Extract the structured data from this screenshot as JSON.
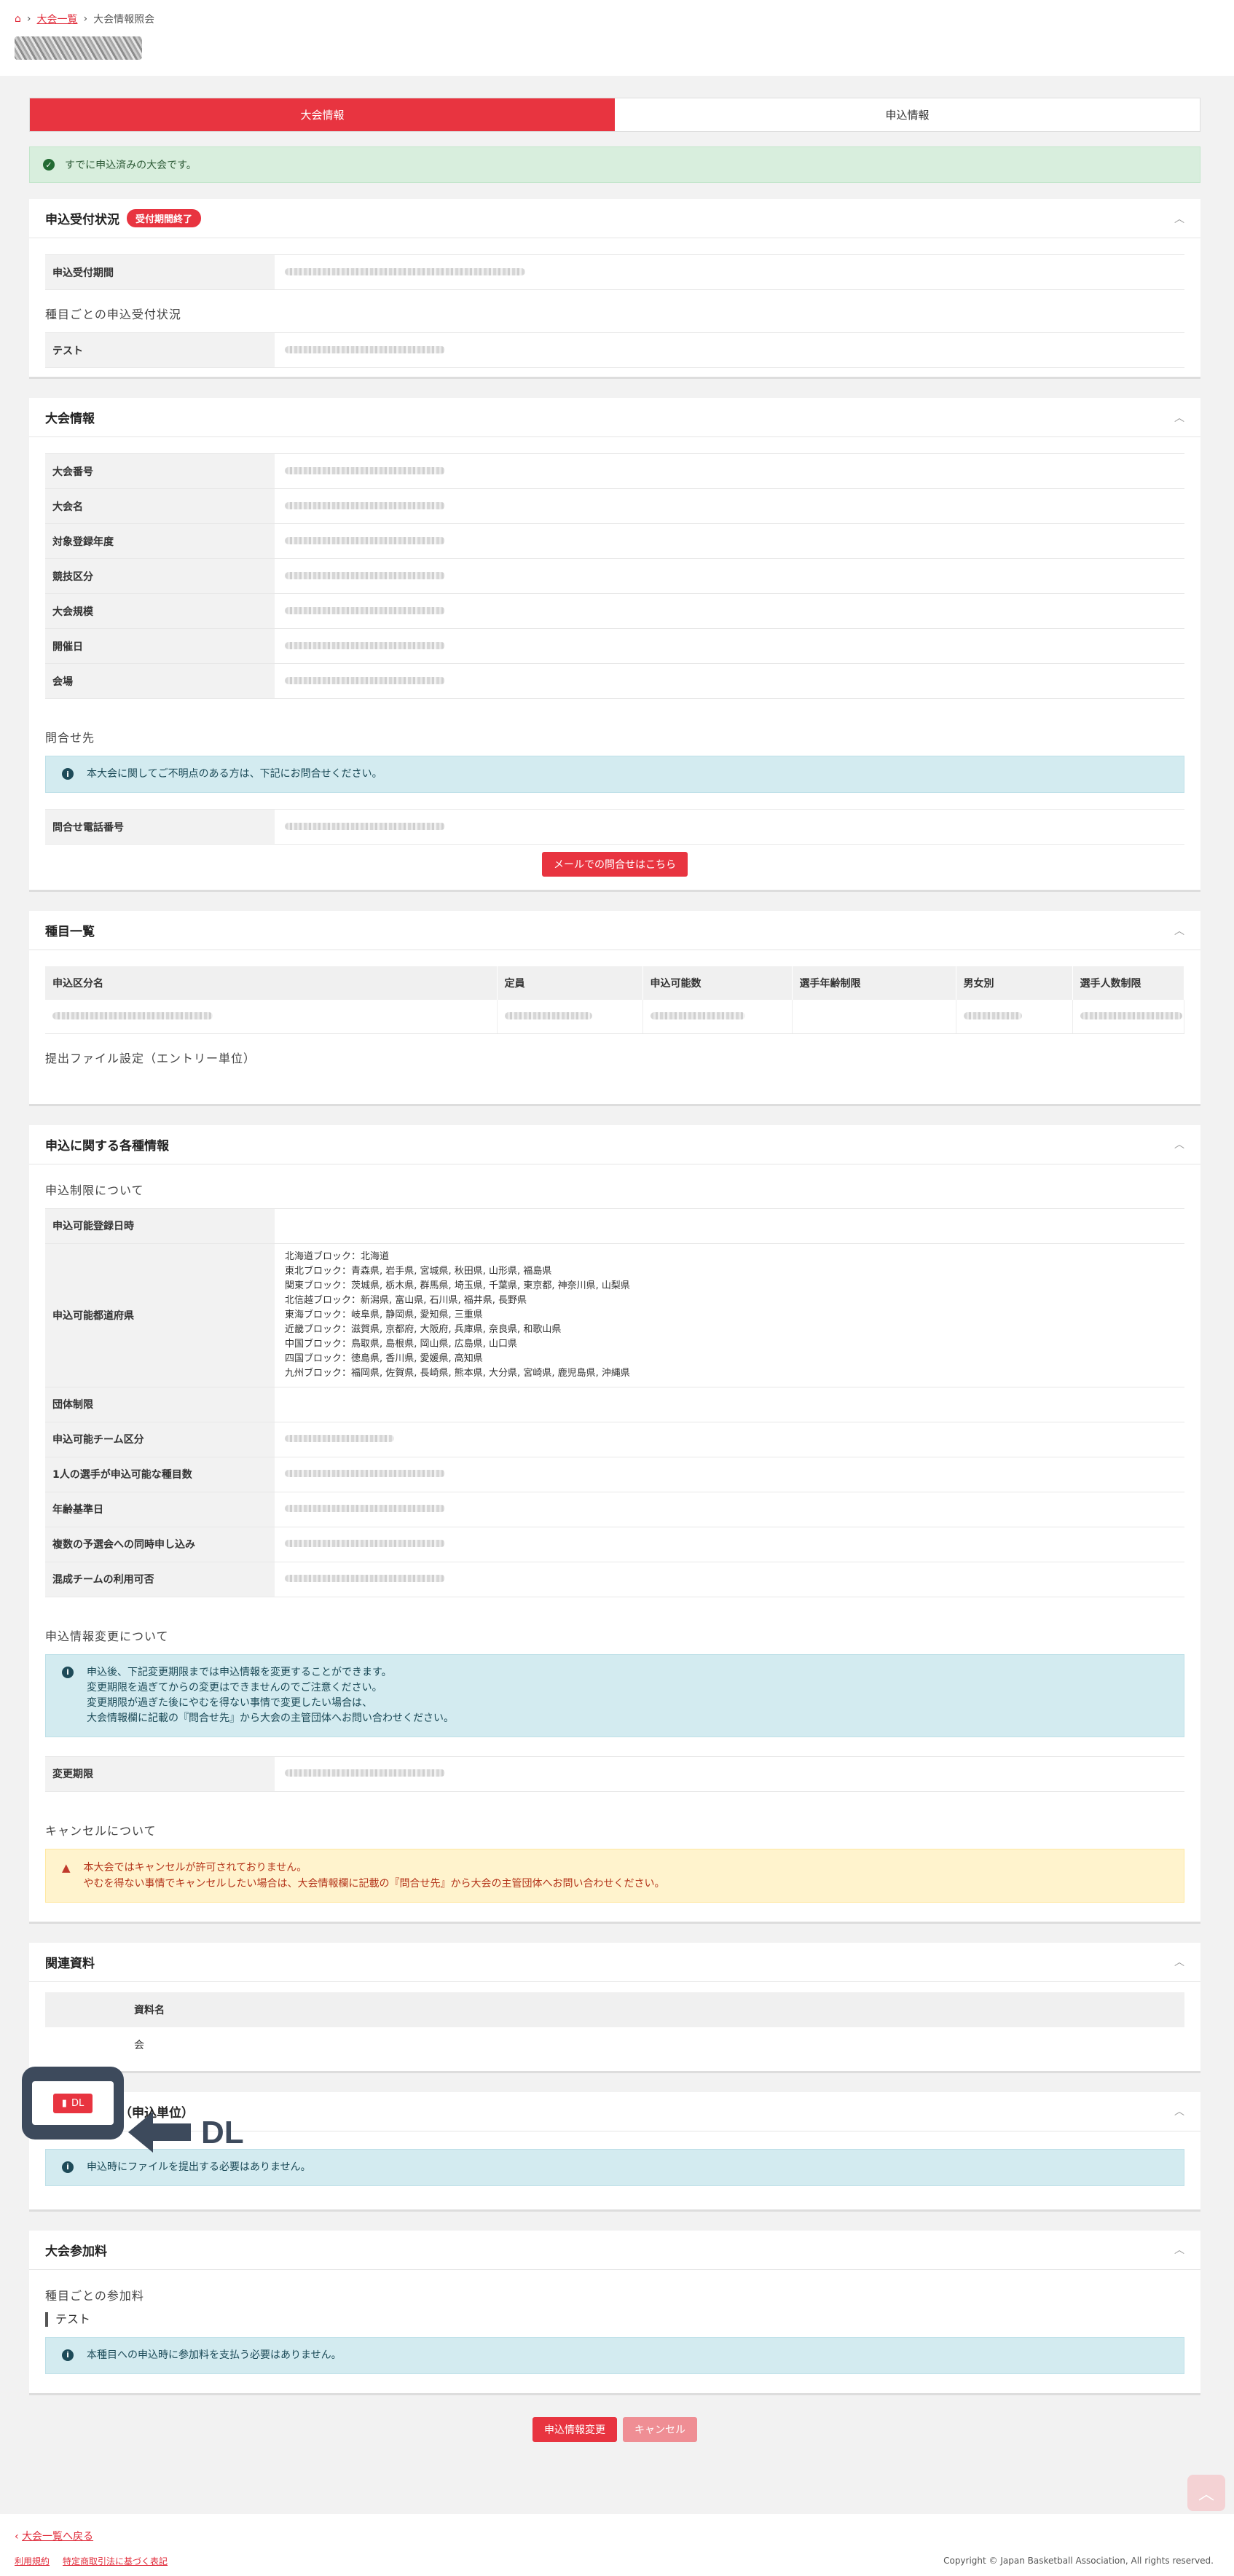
{
  "breadcrumb": {
    "home_icon": "home-icon",
    "link": "大会一覧",
    "current": "大会情報照会"
  },
  "tabs": [
    {
      "label": "大会情報"
    },
    {
      "label": "申込情報"
    }
  ],
  "alert": {
    "text": "すでに申込済みの大会です。"
  },
  "reception": {
    "title": "申込受付状況",
    "badge": "受付期間終了",
    "rows": [
      {
        "label": "申込受付期間"
      }
    ],
    "sub_title": "種目ごとの申込受付状況",
    "event_rows": [
      {
        "label": "テスト"
      }
    ]
  },
  "tournament": {
    "title": "大会情報",
    "rows": [
      "大会番号",
      "大会名",
      "対象登録年度",
      "競技区分",
      "大会規模",
      "開催日",
      "会場"
    ],
    "contact_title": "問合せ先",
    "contact_info": "本大会に関してご不明点のある方は、下記にお問合せください。",
    "phone_label": "問合せ電話番号",
    "mail_button": "メールでの問合せはこちら"
  },
  "events": {
    "title": "種目一覧",
    "columns": [
      "申込区分名",
      "定員",
      "申込可能数",
      "選手年齢制限",
      "男女別",
      "選手人数制限"
    ],
    "file_settings": "提出ファイル設定（エントリー単位）"
  },
  "application": {
    "title": "申込に関する各種情報",
    "limit_title": "申込制限について",
    "rows": [
      {
        "label": "申込可能登録日時"
      },
      {
        "label": "申込可能都道府県"
      },
      {
        "label": "団体制限"
      },
      {
        "label": "申込可能チーム区分"
      },
      {
        "label": "1人の選手が申込可能な種目数"
      },
      {
        "label": "年齢基準日"
      },
      {
        "label": "複数の予選会への同時申し込み"
      },
      {
        "label": "混成チームの利用可否"
      }
    ],
    "prefectures": [
      "北海道ブロック：北海道",
      "東北ブロック：青森県, 岩手県, 宮城県, 秋田県, 山形県, 福島県",
      "関東ブロック：茨城県, 栃木県, 群馬県, 埼玉県, 千葉県, 東京都, 神奈川県, 山梨県",
      "北信越ブロック：新潟県, 富山県, 石川県, 福井県, 長野県",
      "東海ブロック：岐阜県, 静岡県, 愛知県, 三重県",
      "近畿ブロック：滋賀県, 京都府, 大阪府, 兵庫県, 奈良県, 和歌山県",
      "中国ブロック：鳥取県, 島根県, 岡山県, 広島県, 山口県",
      "四国ブロック：徳島県, 香川県, 愛媛県, 高知県",
      "九州ブロック：福岡県, 佐賀県, 長崎県, 熊本県, 大分県, 宮崎県, 鹿児島県, 沖縄県"
    ],
    "change_title": "申込情報変更について",
    "change_info": [
      "申込後、下記変更期限までは申込情報を変更することができます。",
      "変更期限を過ぎてからの変更はできませんのでご注意ください。",
      "変更期限が過ぎた後にやむを得ない事情で変更したい場合は、",
      "大会情報欄に記載の『問合せ先』から大会の主管団体へお問い合わせください。"
    ],
    "change_label": "変更期限",
    "cancel_title": "キャンセルについて",
    "cancel_warn": [
      "本大会ではキャンセルが許可されておりません。",
      "やむを得ない事情でキャンセルしたい場合は、大会情報欄に記載の『問合せ先』から大会の主管団体へお問い合わせください。"
    ]
  },
  "documents": {
    "title": "関連資料",
    "column": "資料名",
    "row_partial": "会"
  },
  "submit_files": {
    "title": "提出ファイル（申込単位）",
    "info": "申込時にファイルを提出する必要はありません。"
  },
  "fee": {
    "title": "大会参加料",
    "sub_title": "種目ごとの参加料",
    "event": "テスト",
    "info": "本種目への申込時に参加料を支払う必要はありません。"
  },
  "actions": {
    "change": "申込情報変更",
    "cancel": "キャンセル"
  },
  "footer": {
    "back": "大会一覧へ戻る",
    "terms": "利用規約",
    "law": "特定商取引法に基づく表記",
    "copyright": "Copyright © Japan Basketball Association, All rights reserved."
  },
  "overlay": {
    "button": "DL",
    "label": "DL"
  },
  "colors": {
    "accent": "#e83440",
    "success_bg": "#d8eedd",
    "info_bg": "#d3ebf0",
    "warn_bg": "#fff3cd",
    "overlay": "#3d4a5c"
  }
}
